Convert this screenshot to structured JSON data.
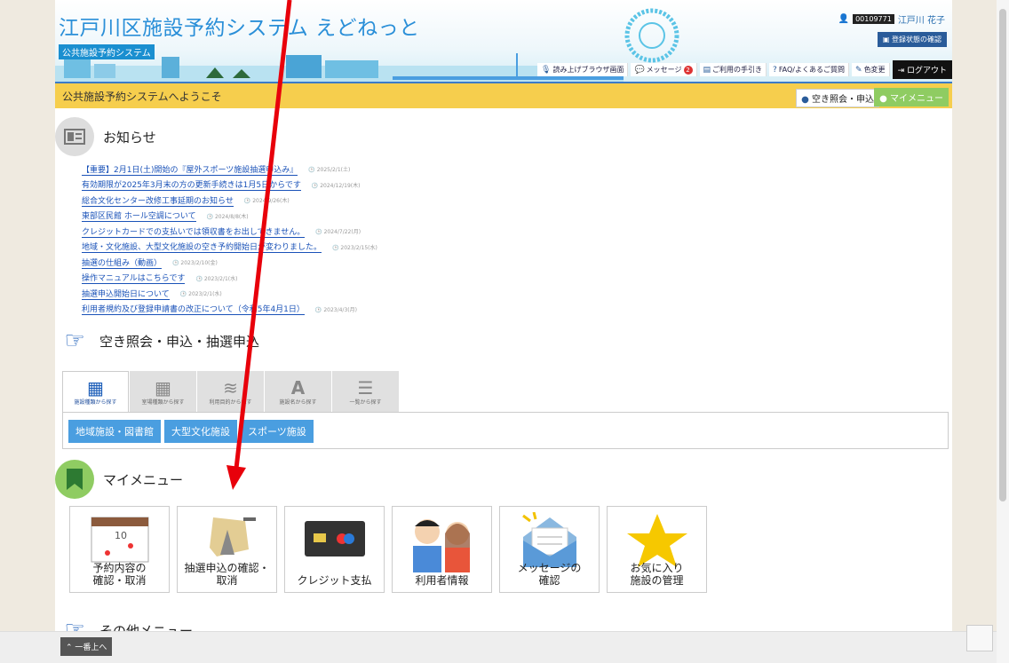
{
  "header": {
    "title": "江戸川区施設予約システム えどねっと",
    "badge": "公共施設予約システム",
    "user_id": "00109771",
    "user_name": "江戸川 花子",
    "registration_button": "登録状態の確認",
    "nav": {
      "reader": "読み上げブラウザ画面",
      "message": "メッセージ",
      "message_count": "2",
      "guide": "ご利用の手引き",
      "faq": "FAQ/よくあるご質問",
      "color": "色変更",
      "logout": "ログアウト"
    }
  },
  "welcome": {
    "text": "公共施設予約システムへようこそ",
    "availability_button": "空き照会・申込",
    "mymenu_button": "マイメニュー"
  },
  "news": {
    "title": "お知らせ",
    "items": [
      {
        "text": "【重要】2月1日(土)開始の『屋外スポーツ施設抽選申込み』",
        "date": "2025/2/1(土)"
      },
      {
        "text": "有効期限が2025年3月末の方の更新手続きは1月5日からです",
        "date": "2024/12/19(木)"
      },
      {
        "text": "総合文化センター改修工事延期のお知らせ",
        "date": "2024/9/26(木)"
      },
      {
        "text": "東部区民館 ホール空調について",
        "date": "2024/8/8(木)"
      },
      {
        "text": "クレジットカードでの支払いでは領収書をお出しできません。",
        "date": "2024/7/22(月)"
      },
      {
        "text": "地域・文化施設、大型文化施設の空き予約開始日が変わりました。",
        "date": "2023/2/15(水)"
      },
      {
        "text": "抽選の仕組み（動画）",
        "date": "2023/2/10(金)"
      },
      {
        "text": "操作マニュアルはこちらです",
        "date": "2023/2/1(水)"
      },
      {
        "text": "抽選申込開始日について",
        "date": "2023/2/1(水)"
      },
      {
        "text": "利用者規約及び登録申請書の改正について（令和5年4月1日）",
        "date": "2023/4/3(月)"
      }
    ]
  },
  "search": {
    "title": "空き照会・申込・抽選申込",
    "tabs": [
      "施設種類から探す",
      "室場種類から探す",
      "利用目的から探す",
      "施設名から探す",
      "一覧から探す"
    ],
    "facilities": [
      "地域施設・図書館",
      "大型文化施設",
      "スポーツ施設"
    ]
  },
  "mymenu": {
    "title": "マイメニュー",
    "items": [
      {
        "line1": "予約内容の",
        "line2": "確認・取消"
      },
      {
        "line1": "抽選申込の確認・",
        "line2": "取消"
      },
      {
        "line1": "クレジット支払",
        "line2": ""
      },
      {
        "line1": "利用者情報",
        "line2": ""
      },
      {
        "line1": "メッセージの",
        "line2": "確認"
      },
      {
        "line1": "お気に入り",
        "line2": "施設の管理"
      }
    ]
  },
  "other_menu": {
    "title": "その他メニュー"
  },
  "footer": {
    "top_button": "一番上へ"
  },
  "colors": {
    "accent_blue": "#2a8fd8",
    "welcome_yellow": "#f6ce4d",
    "mymenu_green": "#8fcc62",
    "arrow_red": "#e8000b"
  }
}
